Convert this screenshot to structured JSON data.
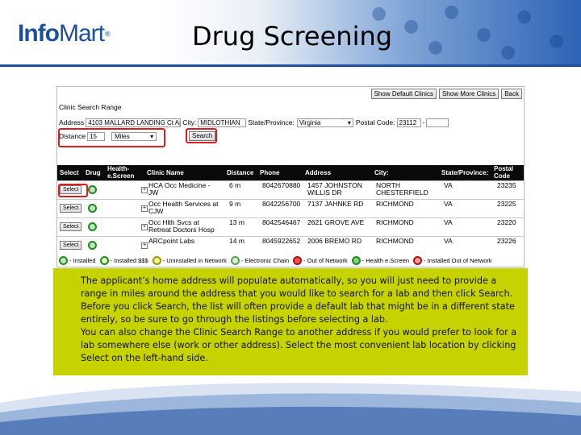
{
  "slide": {
    "logo_text_a": "Info",
    "logo_text_b": "Mart",
    "logo_reg": "®",
    "title": "Drug Screening"
  },
  "form": {
    "buttons": [
      "Show Default Clinics",
      "Show More Clinics",
      "Back"
    ],
    "clinic_search_range_label": "Clinic Search Range",
    "address_label": "Address",
    "address_value": "4103 MALLARD LANDING Ct Ap",
    "city_label": "City:",
    "city_value": "MIDLOTHIAN",
    "state_label": "State/Province:",
    "state_value": "Virginia",
    "postal_label": "Postal Code:",
    "postal_value": "23112",
    "postal_dash": "-",
    "distance_label": "Distance",
    "distance_value": "15",
    "distance_unit": "Miles",
    "search_button": "Search"
  },
  "table": {
    "headers": {
      "select": "Select",
      "drug": "Drug",
      "health_a": "Health-",
      "health_b": "e.Screen",
      "clinic": "Clinic Name",
      "distance": "Distance",
      "phone": "Phone",
      "address": "Address",
      "city": "City:",
      "state": "State/Province:",
      "postal_a": "Postal",
      "postal_b": "Code"
    },
    "rows": [
      {
        "select": "Select",
        "clinic_a": "HCA Occ Medicine -",
        "clinic_b": "JW",
        "distance": "6 m",
        "phone": "8042670880",
        "address_a": "1457 JOHNSTON",
        "address_b": "WILLIS DR",
        "city_a": "NORTH",
        "city_b": "CHESTERFIELD",
        "state": "VA",
        "postal": "23235"
      },
      {
        "select": "Select",
        "clinic_a": "Occ Health Services at",
        "clinic_b": "CJW",
        "distance": "9 m",
        "phone": "8042256700",
        "address_a": "7137 JAHNKE RD",
        "address_b": "",
        "city_a": "RICHMOND",
        "city_b": "",
        "state": "VA",
        "postal": "23225"
      },
      {
        "select": "Select",
        "clinic_a": "Occ Hlth Svcs at",
        "clinic_b": "Retreat Doctors Hosp",
        "distance": "13 m",
        "phone": "8042546467",
        "address_a": "2621 GROVE AVE",
        "address_b": "",
        "city_a": "RICHMOND",
        "city_b": "",
        "state": "VA",
        "postal": "23220"
      },
      {
        "select": "Select",
        "clinic_a": "ARCpoint Labs",
        "clinic_b": "",
        "distance": "14 m",
        "phone": "8045922652",
        "address_a": "2006 BREMO RD",
        "address_b": "",
        "city_a": "RICHMOND",
        "city_b": "",
        "state": "VA",
        "postal": "23226"
      }
    ]
  },
  "legend": [
    "- Installed",
    "- Installed $$$",
    "- Uninstalled in Network",
    "- Electronic Chain",
    "- Out of Network",
    "- Health e.Screen",
    "- Installed Out of Network"
  ],
  "note": {
    "paragraph_1": "The applicant’s home address will populate automatically, so you will just need to provide a range in miles around the address that you would like to search for a lab and then click Search. Before you click Search, the list will often provide a default lab that might be in a different state entirely, so be sure to go through the listings before selecting a lab.",
    "paragraph_2": "You can also change the Clinic Search Range to another address if you would prefer to look for a lab somewhere else (work or other address). Select the most convenient lab location by clicking Select on the left-hand side."
  },
  "colors": {
    "brand_blue": "#1d4f9e",
    "note_bg": "#c6d300",
    "highlight_red": "#d81e1e",
    "installed_green": "#1f8a1f"
  }
}
